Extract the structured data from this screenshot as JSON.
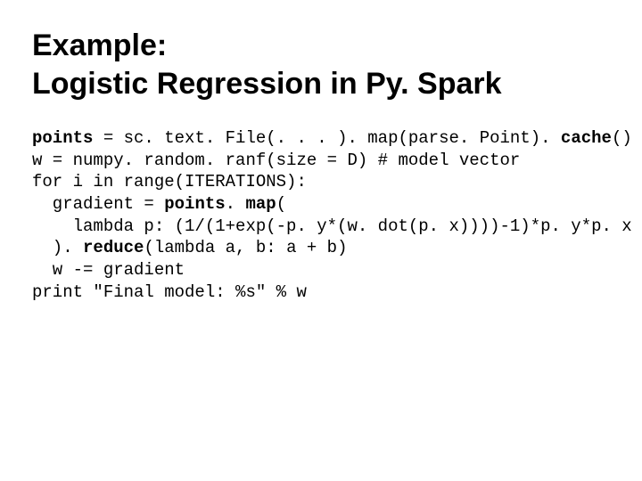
{
  "title_line1": "Example:",
  "title_line2": "Logistic Regression in Py. Spark",
  "code": {
    "l1a": "points",
    "l1b": " = sc. text. File(. . . ). map(parse. Point). ",
    "l1c": "cache",
    "l1d": "()",
    "l2": "w = numpy. random. ranf(size = D) # model vector",
    "l3": "for i in range(ITERATIONS):",
    "l4a": "  gradient = ",
    "l4b": "points",
    "l4c": ". ",
    "l4d": "map",
    "l4e": "(",
    "l5": "    lambda p: (1/(1+exp(-p. y*(w. dot(p. x))))-1)*p. y*p. x",
    "l6a": "  ). ",
    "l6b": "reduce",
    "l6c": "(lambda a, b: a + b)",
    "l7": "  w -= gradient",
    "l8": "print \"Final model: %s\" % w"
  }
}
